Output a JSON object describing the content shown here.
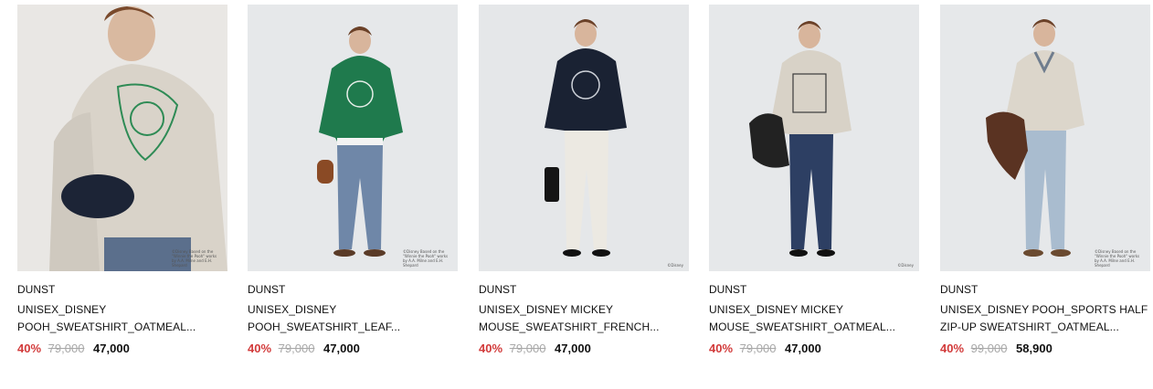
{
  "products": [
    {
      "brand": "DUNST",
      "title_line1": "UNISEX_DISNEY",
      "title_line2": "POOH_SWEATSHIRT_OATMEAL...",
      "discount": "40%",
      "original_price": "79,000",
      "sale_price": "47,000",
      "image_note": "©Disney Based on the \"Winnie the Pooh\" works by A.A. Milne and E.H. Shepard",
      "sweatshirt_color": "#d9d3c9",
      "pants_color": "#5b6f8c"
    },
    {
      "brand": "DUNST",
      "title_line1": "UNISEX_DISNEY",
      "title_line2": "POOH_SWEATSHIRT_LEAF...",
      "discount": "40%",
      "original_price": "79,000",
      "sale_price": "47,000",
      "image_note": "©Disney Based on the \"Winnie the Pooh\" works by A.A. Milne and E.H. Shepard",
      "sweatshirt_color": "#1f7a4d",
      "pants_color": "#6f87a8"
    },
    {
      "brand": "DUNST",
      "title_line1": "UNISEX_DISNEY MICKEY",
      "title_line2": "MOUSE_SWEATSHIRT_FRENCH...",
      "discount": "40%",
      "original_price": "79,000",
      "sale_price": "47,000",
      "image_note": "©Disney",
      "sweatshirt_color": "#1a2233",
      "pants_color": "#ece9e2"
    },
    {
      "brand": "DUNST",
      "title_line1": "UNISEX_DISNEY MICKEY",
      "title_line2": "MOUSE_SWEATSHIRT_OATMEAL...",
      "discount": "40%",
      "original_price": "79,000",
      "sale_price": "47,000",
      "image_note": "©Disney",
      "sweatshirt_color": "#d8d2c7",
      "pants_color": "#2d3f63"
    },
    {
      "brand": "DUNST",
      "title_line1": "UNISEX_DISNEY POOH_SPORTS HALF",
      "title_line2": "ZIP-UP SWEATSHIRT_OATMEAL...",
      "discount": "40%",
      "original_price": "99,000",
      "sale_price": "58,900",
      "image_note": "©Disney Based on the \"Winnie the Pooh\" works by A.A. Milne and E.H. Shepard",
      "sweatshirt_color": "#dcd6cb",
      "pants_color": "#a9bccf"
    }
  ],
  "colors": {
    "discount": "#d23a3a",
    "original_price": "#a8a8a8",
    "text": "#111111",
    "image_background": "#e4e6e8"
  }
}
